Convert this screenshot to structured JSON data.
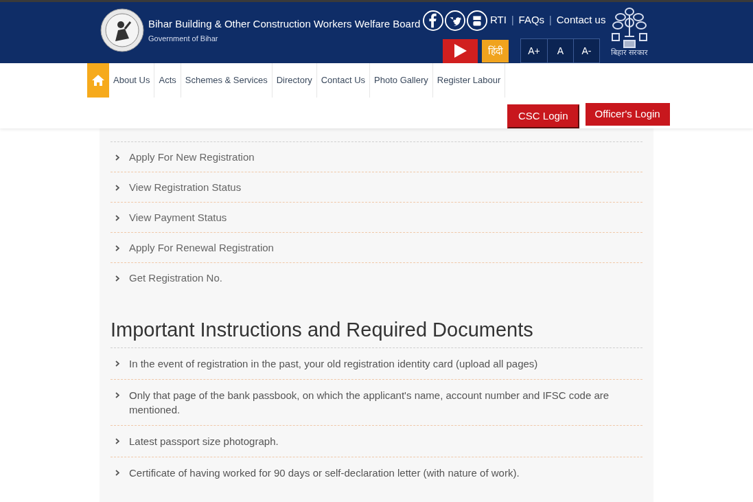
{
  "header": {
    "title": "Bihar Building & Other Construction Workers Welfare Board",
    "subtitle": "Government of Bihar",
    "top_links": [
      "RTI",
      "FAQs",
      "Contact us"
    ],
    "link_separator": "|",
    "language_button": "हिंदी",
    "font_buttons": [
      "A+",
      "A",
      "A-"
    ],
    "emblem_caption": "बिहार सरकार"
  },
  "nav": {
    "items": [
      {
        "label": "About Us",
        "selected": false
      },
      {
        "label": "Acts",
        "selected": false
      },
      {
        "label": "Schemes & Services",
        "selected": false
      },
      {
        "label": "Directory",
        "selected": false
      },
      {
        "label": "Contact Us",
        "selected": false
      },
      {
        "label": "Photo Gallery",
        "selected": false
      },
      {
        "label": "Register Labour",
        "selected": false
      }
    ],
    "home_selected": true,
    "login_buttons": [
      "CSC Login",
      "Officer's Login"
    ]
  },
  "registration_links": [
    "Apply For New Registration",
    "View Registration Status",
    "View Payment Status",
    "Apply For Renewal Registration",
    "Get Registration No."
  ],
  "instructions": {
    "heading": "Important Instructions and Required Documents",
    "items": [
      "In the event of registration in the past, your old registration identity card (upload all pages)",
      "Only that page of the bank passbook, on which the applicant's name, account number and IFSC code are mentioned.",
      "Latest passport size photograph.",
      "Certificate of having worked for 90 days or self-declaration letter (with nature of work)."
    ]
  }
}
